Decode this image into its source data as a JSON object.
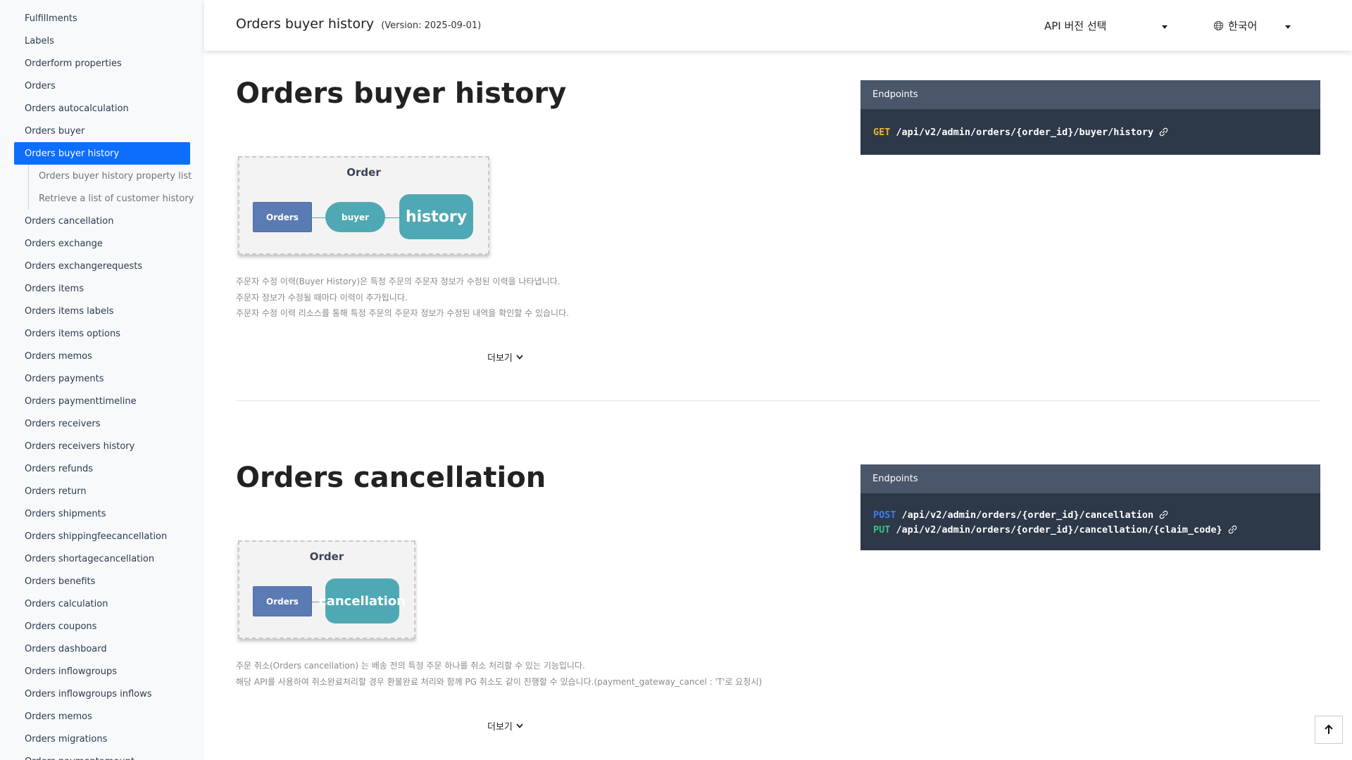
{
  "sidebar": {
    "items_before": [
      "Fulfillments",
      "Labels",
      "Orderform properties",
      "Orders",
      "Orders autocalculation",
      "Orders buyer"
    ],
    "active_item": "Orders buyer history",
    "sub_items": [
      "Orders buyer history property list",
      "Retrieve a list of customer history of"
    ],
    "items_after": [
      "Orders cancellation",
      "Orders exchange",
      "Orders exchangerequests",
      "Orders items",
      "Orders items labels",
      "Orders items options",
      "Orders memos",
      "Orders payments",
      "Orders paymenttimeline",
      "Orders receivers",
      "Orders receivers history",
      "Orders refunds",
      "Orders return",
      "Orders shipments",
      "Orders shippingfeecancellation",
      "Orders shortagecancellation",
      "Orders benefits",
      "Orders calculation",
      "Orders coupons",
      "Orders dashboard",
      "Orders inflowgroups",
      "Orders inflowgroups inflows",
      "Orders memos",
      "Orders migrations",
      "Orders paymentamount"
    ]
  },
  "header": {
    "title": "Orders buyer history",
    "version": "(Version: 2025-09-01)",
    "api_select_label": "API 버전 선택",
    "language_label": "한국어"
  },
  "sections": [
    {
      "title": "Orders buyer history",
      "diagram": {
        "label": "Order",
        "nodes": [
          "Orders",
          "buyer",
          "history"
        ]
      },
      "description": [
        "주문자 수정 이력(Buyer History)은 특정 주문의 주문자 정보가 수정된 이력을 나타냅니다.",
        "주문자 정보가 수정될 때마다 이력이 추가됩니다.",
        "주문자 수정 이력 리소스를 통해 특정 주문의 주문자 정보가 수정된 내역을 확인할 수 있습니다."
      ],
      "more_label": "더보기",
      "endpoints_label": "Endpoints",
      "endpoints": [
        {
          "method": "GET",
          "path": "/api/v2/admin/orders/{order_id}/buyer/history"
        }
      ]
    },
    {
      "title": "Orders cancellation",
      "diagram": {
        "label": "Order",
        "nodes": [
          "Orders",
          "cancellation"
        ]
      },
      "description": [
        "주문 취소(Orders cancellation) 는 배송 전의 특정 주문 하나를 취소 처리할 수 있는 기능입니다.",
        "해당 API를 사용하여 취소완료처리할 경우 환불완료 처리와 함께 PG 취소도 같이 진행할 수 있습니다.(payment_gateway_cancel : 'T'로 요청시)"
      ],
      "more_label": "더보기",
      "endpoints_label": "Endpoints",
      "endpoints": [
        {
          "method": "POST",
          "path": "/api/v2/admin/orders/{order_id}/cancellation"
        },
        {
          "method": "PUT",
          "path": "/api/v2/admin/orders/{order_id}/cancellation/{claim_code}"
        }
      ]
    }
  ],
  "icons": {
    "globe": "globe-icon",
    "link": "link-icon",
    "chevron": "chevron-down-icon",
    "scroll_top": "arrow-up-icon"
  },
  "colors": {
    "active": "#0d6efd",
    "endpoint_bg": "#2d3848",
    "endpoint_head": "#4a566a",
    "get": "#f0b429",
    "post": "#3d7cf0",
    "put": "#37c48a"
  }
}
